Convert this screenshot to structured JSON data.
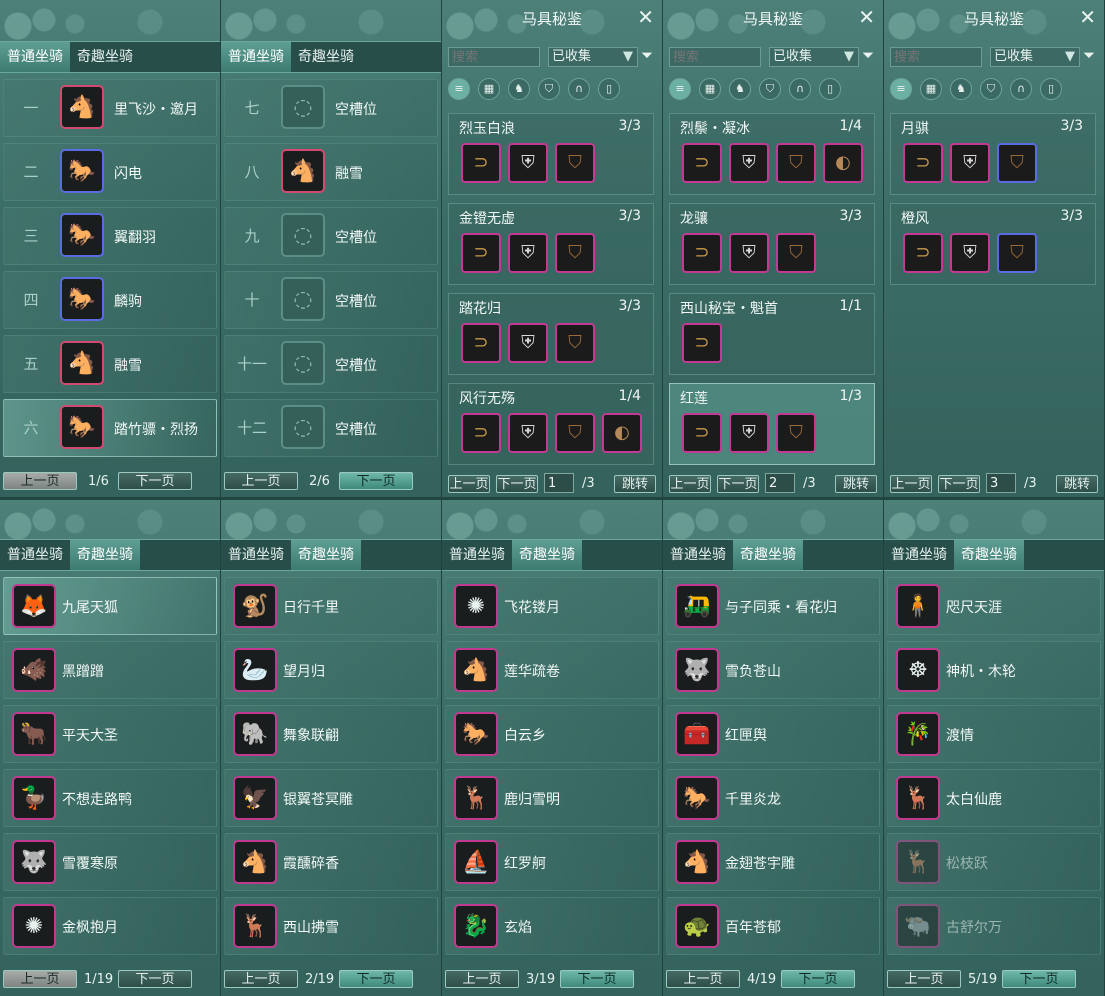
{
  "tabs": {
    "normal": "普通坐骑",
    "fun": "奇趣坐骑"
  },
  "pager": {
    "prev": "上一页",
    "next": "下一页",
    "jump": "跳转"
  },
  "top_panels": [
    {
      "page_text": "1/6",
      "slots": [
        {
          "num": "一",
          "name": "里飞沙・邀月",
          "icon": "white-horse-icon",
          "border": "red"
        },
        {
          "num": "二",
          "name": "闪电",
          "icon": "black-horse-icon",
          "border": "blue"
        },
        {
          "num": "三",
          "name": "翼翻羽",
          "icon": "black-horse-icon",
          "border": "blue"
        },
        {
          "num": "四",
          "name": "麟驹",
          "icon": "black-horse-icon",
          "border": "blue"
        },
        {
          "num": "五",
          "name": "融雪",
          "icon": "white-horse-icon",
          "border": "red"
        },
        {
          "num": "六",
          "name": "踏竹骠・烈扬",
          "icon": "red-maned-horse-icon",
          "border": "red"
        }
      ]
    },
    {
      "page_text": "2/6",
      "slots": [
        {
          "num": "七",
          "name": "空槽位",
          "icon": "empty-slot-icon",
          "border": "empty"
        },
        {
          "num": "八",
          "name": "融雪",
          "icon": "white-horse-icon",
          "border": "red"
        },
        {
          "num": "九",
          "name": "空槽位",
          "icon": "empty-slot-icon",
          "border": "empty"
        },
        {
          "num": "十",
          "name": "空槽位",
          "icon": "empty-slot-icon",
          "border": "empty"
        },
        {
          "num": "十一",
          "name": "空槽位",
          "icon": "empty-slot-icon",
          "border": "empty"
        },
        {
          "num": "十二",
          "name": "空槽位",
          "icon": "empty-slot-icon",
          "border": "empty"
        }
      ]
    }
  ],
  "codex_panels": [
    {
      "title": "马具秘鉴",
      "search_placeholder": "搜索",
      "filter_value": "已收集",
      "page_input": "1",
      "page_total": "/3",
      "sets": [
        {
          "name": "烈玉白浪",
          "count": "3/3",
          "pieces": 3
        },
        {
          "name": "金镫无虚",
          "count": "3/3",
          "pieces": 3
        },
        {
          "name": "踏花归",
          "count": "3/3",
          "pieces": 3
        },
        {
          "name": "风行无殇",
          "count": "1/4",
          "pieces": 4
        }
      ]
    },
    {
      "title": "马具秘鉴",
      "search_placeholder": "搜索",
      "filter_value": "已收集",
      "page_input": "2",
      "page_total": "/3",
      "sets": [
        {
          "name": "烈鬃・凝冰",
          "count": "1/4",
          "pieces": 4
        },
        {
          "name": "龙骧",
          "count": "3/3",
          "pieces": 3
        },
        {
          "name": "西山秘宝・魁首",
          "count": "1/1",
          "pieces": 1
        },
        {
          "name": "红莲",
          "count": "1/3",
          "pieces": 3
        }
      ]
    },
    {
      "title": "马具秘鉴",
      "search_placeholder": "搜索",
      "filter_value": "已收集",
      "page_input": "3",
      "page_total": "/3",
      "sets": [
        {
          "name": "月骐",
          "count": "3/3",
          "pieces": 3
        },
        {
          "name": "橙风",
          "count": "3/3",
          "pieces": 3
        }
      ]
    }
  ],
  "bottom_panels": [
    {
      "page_text": "1/19",
      "items": [
        {
          "name": "九尾天狐",
          "icon": "white-fox-icon"
        },
        {
          "name": "黑蹭蹭",
          "icon": "black-creature-icon"
        },
        {
          "name": "平天大圣",
          "icon": "bull-icon"
        },
        {
          "name": "不想走路鸭",
          "icon": "duck-icon"
        },
        {
          "name": "雪覆寒原",
          "icon": "white-beast-icon"
        },
        {
          "name": "金枫抱月",
          "icon": "golden-orb-icon"
        }
      ]
    },
    {
      "page_text": "2/19",
      "items": [
        {
          "name": "日行千里",
          "icon": "monkey-icon"
        },
        {
          "name": "望月归",
          "icon": "crane-icon"
        },
        {
          "name": "舞象联翩",
          "icon": "elephant-icon"
        },
        {
          "name": "银翼苍冥雕",
          "icon": "eagle-icon"
        },
        {
          "name": "霞醺碎香",
          "icon": "white-horse-icon"
        },
        {
          "name": "西山拂雪",
          "icon": "white-deer-icon"
        }
      ]
    },
    {
      "page_text": "3/19",
      "items": [
        {
          "name": "飞花镂月",
          "icon": "golden-orb-icon"
        },
        {
          "name": "莲华疏卷",
          "icon": "white-horse-icon"
        },
        {
          "name": "白云乡",
          "icon": "cloud-horse-icon"
        },
        {
          "name": "鹿归雪明",
          "icon": "deer-icon"
        },
        {
          "name": "红罗舸",
          "icon": "red-boat-icon"
        },
        {
          "name": "玄焰",
          "icon": "dark-beast-icon"
        }
      ]
    },
    {
      "page_text": "4/19",
      "items": [
        {
          "name": "与子同乘・看花归",
          "icon": "carriage-icon"
        },
        {
          "name": "雪负苍山",
          "icon": "white-beast-icon"
        },
        {
          "name": "红匣舆",
          "icon": "red-chest-icon"
        },
        {
          "name": "千里炎龙",
          "icon": "dark-horse-icon"
        },
        {
          "name": "金翅苍宇雕",
          "icon": "horse-icon"
        },
        {
          "name": "百年苍郁",
          "icon": "turtle-icon"
        }
      ]
    },
    {
      "page_text": "5/19",
      "items": [
        {
          "name": "咫尺天涯",
          "icon": "figure-icon"
        },
        {
          "name": "神机・木轮",
          "icon": "wooden-wheel-icon"
        },
        {
          "name": "渡情",
          "icon": "bamboo-raft-icon"
        },
        {
          "name": "太白仙鹿",
          "icon": "antler-icon"
        },
        {
          "name": "松枝跃",
          "icon": "grey-deer-icon",
          "dim": true
        },
        {
          "name": "古舒尔万",
          "icon": "grey-beast-icon",
          "dim": true
        }
      ]
    }
  ],
  "colors": {
    "accent": "#3e8a7c",
    "rare_border": "#d24a6f",
    "blue_border": "#5a6ce0"
  }
}
